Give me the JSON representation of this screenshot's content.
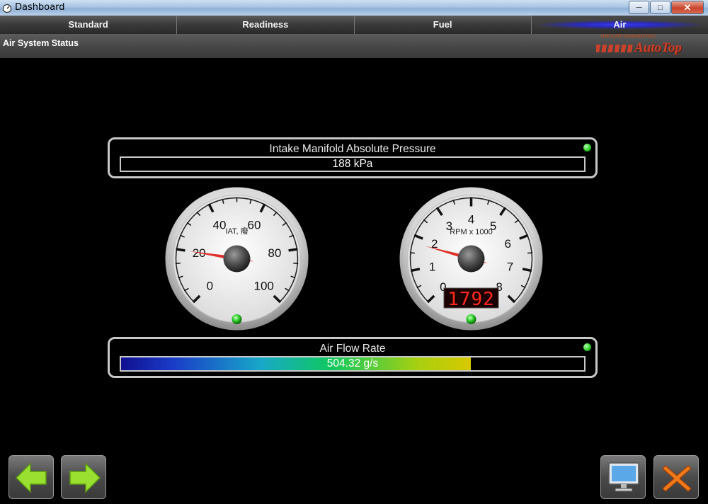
{
  "window": {
    "title": "Dashboard",
    "app_icon": "dashboard-icon",
    "buttons": [
      "minimize-icon",
      "maximize-icon",
      "close-icon"
    ]
  },
  "tabs": [
    {
      "label": "Standard",
      "active": false
    },
    {
      "label": "Readiness",
      "active": false
    },
    {
      "label": "Fuel",
      "active": false
    },
    {
      "label": "Air",
      "active": true
    }
  ],
  "status_title": "Air System Status",
  "logo": {
    "tagline": "TOP AUTO DIAGNOSTICS",
    "brand": "AutoTop"
  },
  "map_panel": {
    "label": "Intake Manifold Absolute Pressure",
    "value": "188 kPa",
    "indicator": "green"
  },
  "iat_gauge": {
    "label": "IAT, 癈",
    "ticks": [
      "0",
      "20",
      "40",
      "60",
      "80",
      "100"
    ],
    "min": 0,
    "max": 100,
    "reading": 20,
    "indicator": "green"
  },
  "rpm_gauge": {
    "label": "RPM x 1000",
    "ticks": [
      "0",
      "1",
      "2",
      "3",
      "4",
      "5",
      "6",
      "7",
      "8"
    ],
    "min": 0,
    "max": 8,
    "reading": 1.792,
    "digital_readout": "1792",
    "indicator": "green"
  },
  "airflow_panel": {
    "label": "Air Flow Rate",
    "value": "504.32 g/s",
    "fill_fraction": 0.755,
    "indicator": "green"
  },
  "bottom_buttons": {
    "previous": "arrow-left-icon",
    "next": "arrow-right-icon",
    "display": "monitor-icon",
    "exit": "close-x-icon"
  },
  "colors": {
    "active_tab": "#2a2ab8",
    "needle": "#e0302a",
    "led": "#2ed02a",
    "digital": "#ff2a1a",
    "nav_arrow": "#9ae030",
    "exit_x": "#f07a1a"
  }
}
